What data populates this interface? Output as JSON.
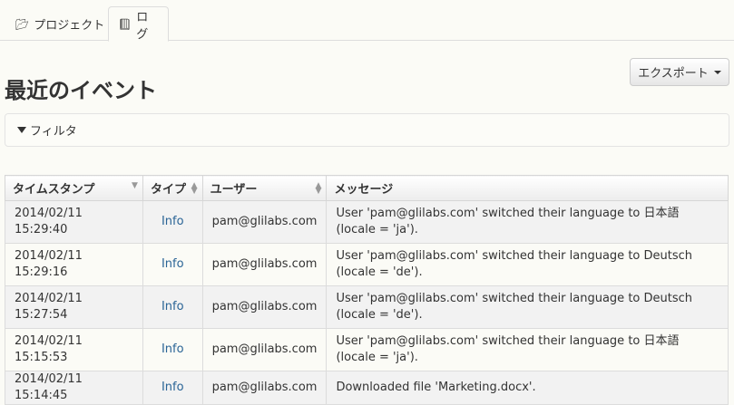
{
  "tabs": [
    {
      "label": "プロジェクト",
      "icon": "folder-open-icon",
      "active": false
    },
    {
      "label": "ログ",
      "icon": "book-icon",
      "active": true
    }
  ],
  "page": {
    "title": "最近のイベント"
  },
  "export": {
    "label": "エクスポート"
  },
  "filter": {
    "label": "フィルタ"
  },
  "table": {
    "columns": [
      "タイムスタンプ",
      "タイプ",
      "ユーザー",
      "メッセージ"
    ],
    "rows": [
      {
        "timestamp": "2014/02/11 15:29:40",
        "type": "Info",
        "user": "pam@glilabs.com",
        "message": "User 'pam@glilabs.com' switched their language to 日本語 (locale = 'ja')."
      },
      {
        "timestamp": "2014/02/11 15:29:16",
        "type": "Info",
        "user": "pam@glilabs.com",
        "message": "User 'pam@glilabs.com' switched their language to Deutsch (locale = 'de')."
      },
      {
        "timestamp": "2014/02/11 15:27:54",
        "type": "Info",
        "user": "pam@glilabs.com",
        "message": "User 'pam@glilabs.com' switched their language to Deutsch (locale = 'de')."
      },
      {
        "timestamp": "2014/02/11 15:15:53",
        "type": "Info",
        "user": "pam@glilabs.com",
        "message": "User 'pam@glilabs.com' switched their language to 日本語 (locale = 'ja')."
      },
      {
        "timestamp": "2014/02/11 15:14:45",
        "type": "Info",
        "user": "pam@glilabs.com",
        "message": "Downloaded file 'Marketing.docx'."
      }
    ]
  },
  "colors": {
    "link": "#2a6496",
    "background": "#fbfbf6"
  }
}
